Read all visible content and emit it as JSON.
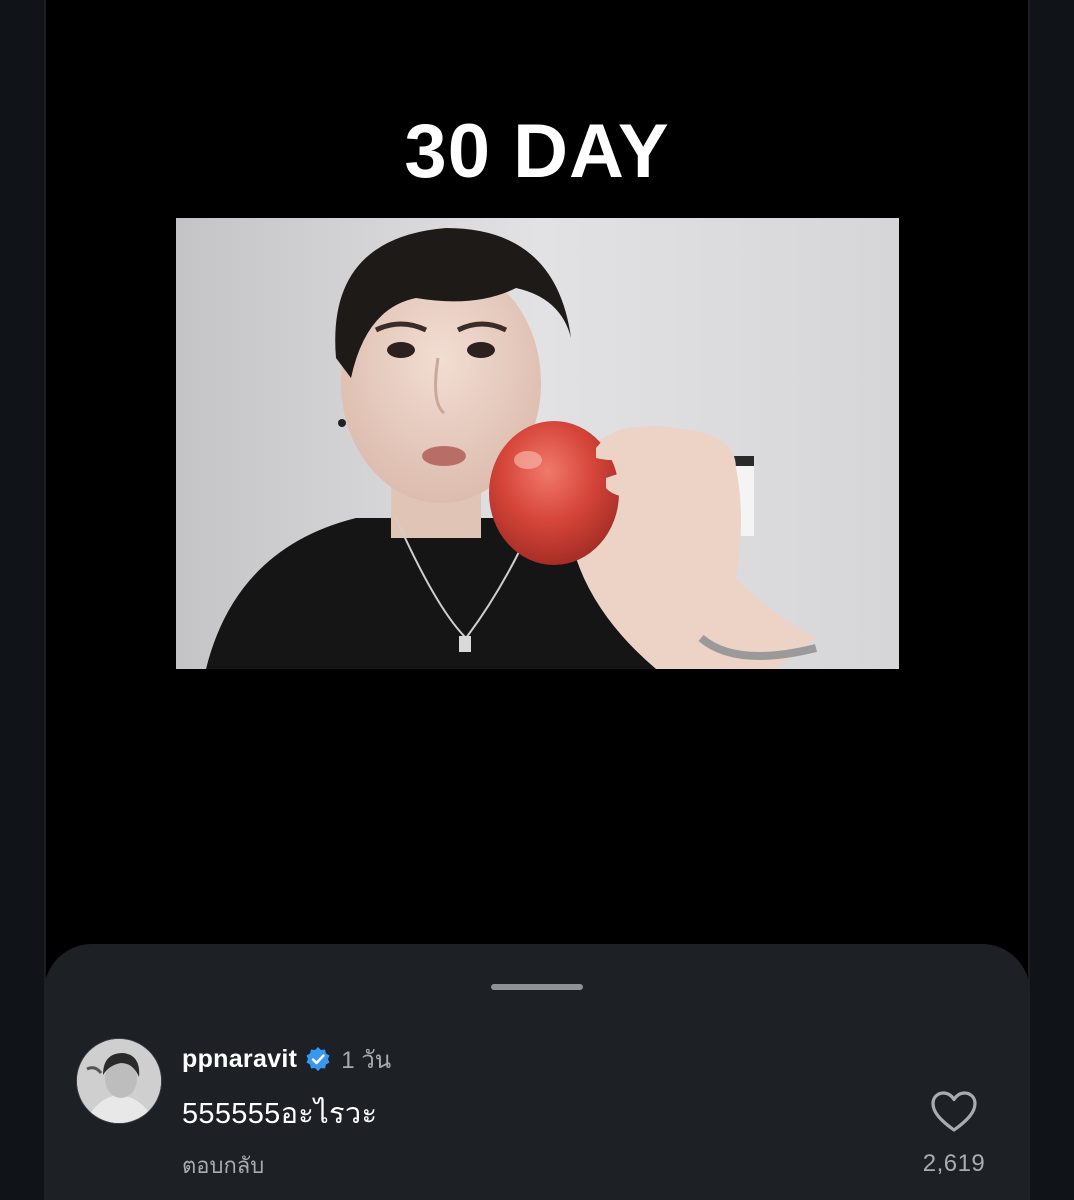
{
  "video": {
    "title": "30 DAY"
  },
  "comment_sheet": {
    "comment": {
      "username": "ppnaravit",
      "verified": true,
      "time": "1 วัน",
      "text": "555555อะไรวะ",
      "reply_label": "ตอบกลับ",
      "like_count": "2,619"
    },
    "icons": {
      "verified": "verified-badge-icon",
      "like": "heart-outline-icon"
    }
  },
  "colors": {
    "background": "#000000",
    "sheet": "#1d2126",
    "verified_blue": "#3897f0",
    "secondary_text": "#a8acb1"
  }
}
